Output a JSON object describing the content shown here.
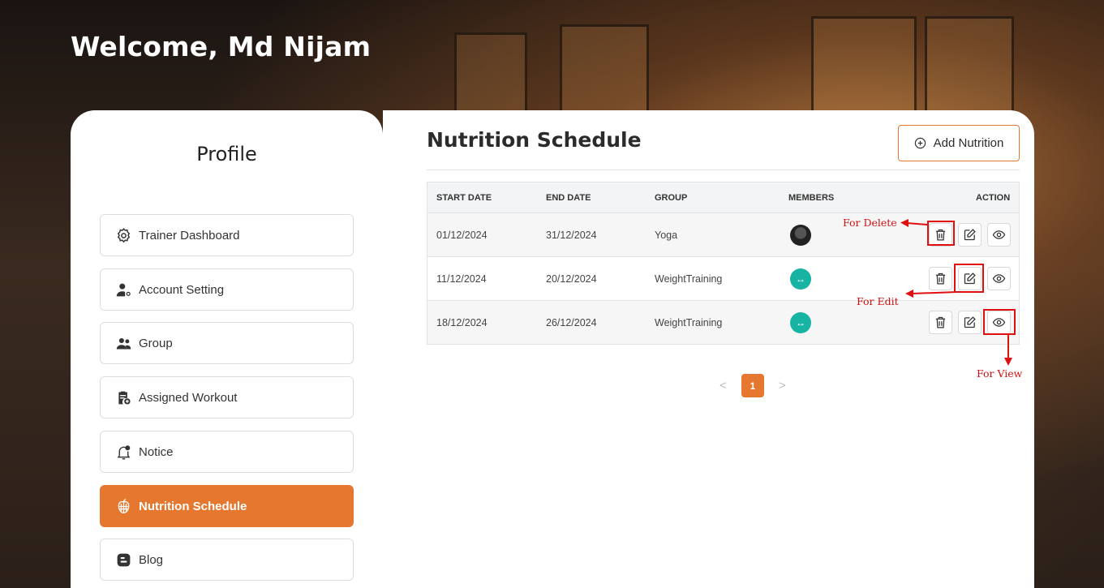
{
  "welcome": "Welcome, Md Nijam",
  "sidebar": {
    "title": "Profile",
    "items": [
      {
        "label": "Trainer Dashboard",
        "icon": "gear-icon"
      },
      {
        "label": "Account Setting",
        "icon": "user-settings-icon"
      },
      {
        "label": "Group",
        "icon": "users-icon"
      },
      {
        "label": "Assigned Workout",
        "icon": "clipboard-plus-icon"
      },
      {
        "label": "Notice",
        "icon": "bell-icon"
      },
      {
        "label": "Nutrition Schedule",
        "icon": "apple-icon",
        "active": true
      },
      {
        "label": "Blog",
        "icon": "blogger-icon"
      }
    ]
  },
  "main": {
    "title": "Nutrition Schedule",
    "add_button": "Add Nutrition",
    "table": {
      "headers": [
        "START DATE",
        "END DATE",
        "GROUP",
        "MEMBERS",
        "ACTION"
      ],
      "rows": [
        {
          "start": "01/12/2024",
          "end": "31/12/2024",
          "group": "Yoga",
          "member": "photo-avatar"
        },
        {
          "start": "11/12/2024",
          "end": "20/12/2024",
          "group": "WeightTraining",
          "member": "teal-avatar"
        },
        {
          "start": "18/12/2024",
          "end": "26/12/2024",
          "group": "WeightTraining",
          "member": "teal-avatar"
        }
      ]
    },
    "pagination": {
      "current": "1",
      "prev": "<",
      "next": ">"
    }
  },
  "annotations": {
    "delete": "For Delete",
    "edit": "For Edit",
    "view": "For View",
    "color": "#e01010"
  },
  "colors": {
    "accent": "#e6772e",
    "teal": "#17b3a3"
  }
}
